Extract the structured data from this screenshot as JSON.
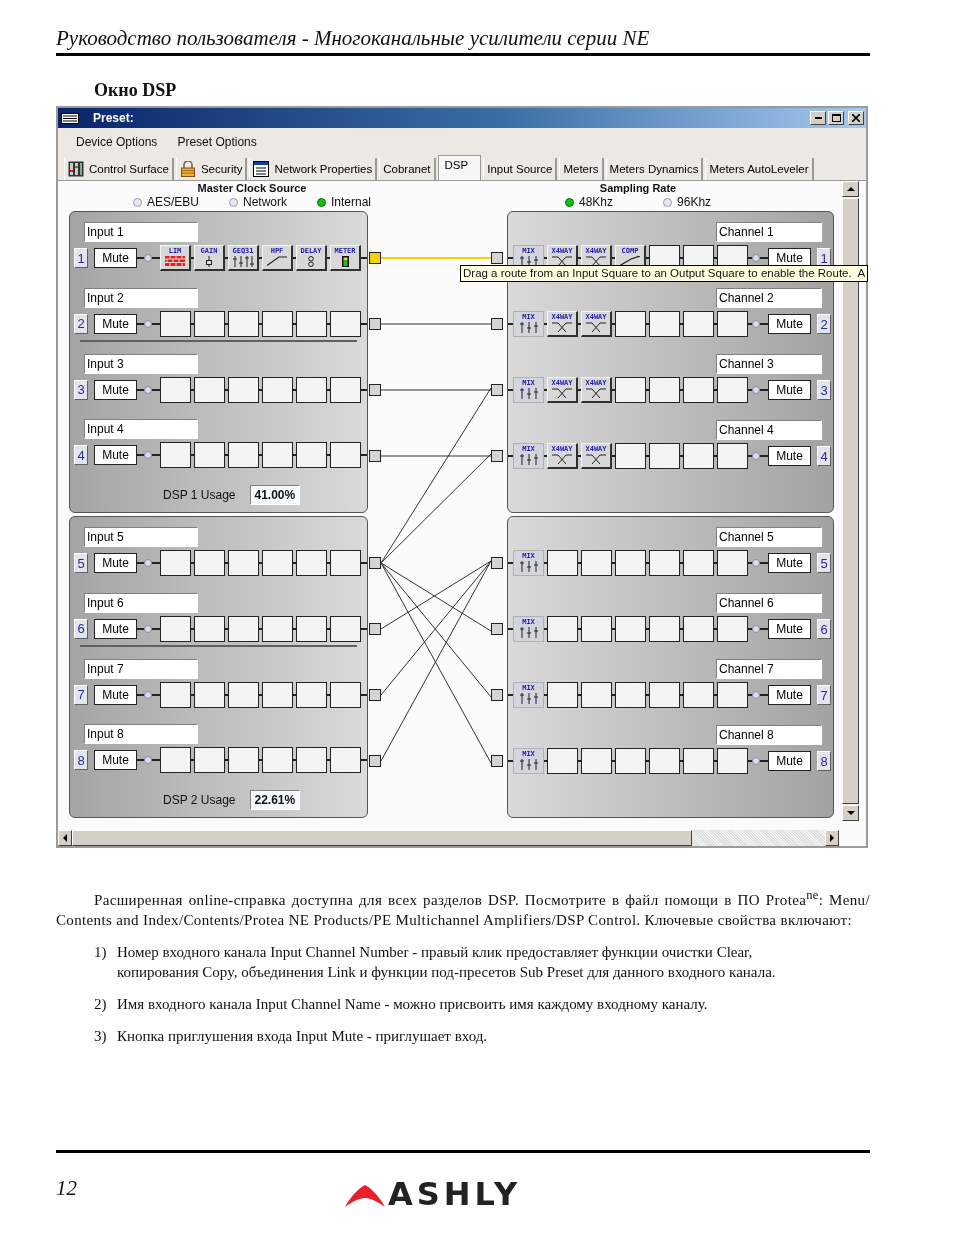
{
  "page_header": {
    "title": "Руководство пользователя - Многоканальные усилители серии NE"
  },
  "section_title": "Окно DSP",
  "window": {
    "title": "Preset:",
    "menu": [
      "Device Options",
      "Preset Options"
    ],
    "tabs": [
      {
        "label": "Control Surface",
        "kind": "surface",
        "selected": false
      },
      {
        "label": "Security",
        "kind": "security",
        "selected": false
      },
      {
        "label": "Network Properties",
        "kind": "network",
        "selected": false
      },
      {
        "label": "Cobranet",
        "kind": "plain",
        "selected": false
      },
      {
        "label": "DSP",
        "kind": "plain",
        "selected": true
      },
      {
        "label": "Input Source",
        "kind": "plain",
        "selected": false
      },
      {
        "label": "Meters",
        "kind": "plain",
        "selected": false
      },
      {
        "label": "Meters Dynamics",
        "kind": "plain",
        "selected": false
      },
      {
        "label": "Meters AutoLeveler",
        "kind": "plain",
        "selected": false
      }
    ],
    "clock_source": {
      "label": "Master Clock Source",
      "options": [
        {
          "label": "AES/EBU",
          "selected": false
        },
        {
          "label": "Network",
          "selected": false
        },
        {
          "label": "Internal",
          "selected": true
        }
      ]
    },
    "sampling_rate": {
      "label": "Sampling Rate",
      "options": [
        {
          "label": "48Khz",
          "selected": true
        },
        {
          "label": "96Khz",
          "selected": false
        }
      ]
    },
    "dsp_units": [
      {
        "usage_label": "DSP 1 Usage",
        "usage": "41.00%",
        "inputs": [
          {
            "number": "1",
            "name": "Input 1",
            "mute": "Mute",
            "route_selected": true,
            "routes": [
              true,
              false,
              false,
              false,
              false,
              false,
              false,
              false
            ],
            "blocks": [
              {
                "kind": "lim",
                "label": "LIM"
              },
              {
                "kind": "gain",
                "label": "GAIN"
              },
              {
                "kind": "geq",
                "label": "GEQ31"
              },
              {
                "kind": "hpf",
                "label": "HPF"
              },
              {
                "kind": "delay",
                "label": "DELAY"
              },
              {
                "kind": "meter",
                "label": "METER"
              }
            ]
          },
          {
            "number": "2",
            "name": "Input 2",
            "mute": "Mute",
            "route_selected": false,
            "routes": [
              false,
              true,
              false,
              false,
              false,
              false,
              false,
              false
            ],
            "blocks": [
              {
                "kind": "empty"
              },
              {
                "kind": "empty"
              },
              {
                "kind": "empty"
              },
              {
                "kind": "empty"
              },
              {
                "kind": "empty"
              },
              {
                "kind": "empty"
              }
            ]
          },
          {
            "number": "3",
            "name": "Input 3",
            "mute": "Mute",
            "route_selected": false,
            "routes": [
              false,
              false,
              true,
              false,
              false,
              false,
              false,
              false
            ],
            "blocks": [
              {
                "kind": "empty"
              },
              {
                "kind": "empty"
              },
              {
                "kind": "empty"
              },
              {
                "kind": "empty"
              },
              {
                "kind": "empty"
              },
              {
                "kind": "empty"
              }
            ]
          },
          {
            "number": "4",
            "name": "Input 4",
            "mute": "Mute",
            "route_selected": false,
            "routes": [
              false,
              false,
              false,
              true,
              false,
              false,
              false,
              false
            ],
            "blocks": [
              {
                "kind": "empty"
              },
              {
                "kind": "empty"
              },
              {
                "kind": "empty"
              },
              {
                "kind": "empty"
              },
              {
                "kind": "empty"
              },
              {
                "kind": "empty"
              }
            ]
          }
        ],
        "outputs": [
          {
            "number": "1",
            "name": "Channel 1",
            "mute": "Mute",
            "blocks": [
              {
                "kind": "mix",
                "label": "MIX"
              },
              {
                "kind": "xover",
                "label": "X4WAY"
              },
              {
                "kind": "xover",
                "label": "X4WAY"
              },
              {
                "kind": "comp",
                "label": "COMP"
              },
              {
                "kind": "empty"
              },
              {
                "kind": "empty"
              },
              {
                "kind": "empty"
              }
            ]
          },
          {
            "number": "2",
            "name": "Channel 2",
            "mute": "Mute",
            "blocks": [
              {
                "kind": "mix",
                "label": "MIX"
              },
              {
                "kind": "xover",
                "label": "X4WAY"
              },
              {
                "kind": "xover",
                "label": "X4WAY"
              },
              {
                "kind": "empty"
              },
              {
                "kind": "empty"
              },
              {
                "kind": "empty"
              },
              {
                "kind": "empty"
              }
            ]
          },
          {
            "number": "3",
            "name": "Channel 3",
            "mute": "Mute",
            "blocks": [
              {
                "kind": "mix",
                "label": "MIX"
              },
              {
                "kind": "xover",
                "label": "X4WAY"
              },
              {
                "kind": "xover",
                "label": "X4WAY"
              },
              {
                "kind": "empty"
              },
              {
                "kind": "empty"
              },
              {
                "kind": "empty"
              },
              {
                "kind": "empty"
              }
            ]
          },
          {
            "number": "4",
            "name": "Channel 4",
            "mute": "Mute",
            "blocks": [
              {
                "kind": "mix",
                "label": "MIX"
              },
              {
                "kind": "xover",
                "label": "X4WAY"
              },
              {
                "kind": "xover",
                "label": "X4WAY"
              },
              {
                "kind": "empty"
              },
              {
                "kind": "empty"
              },
              {
                "kind": "empty"
              },
              {
                "kind": "empty"
              }
            ]
          }
        ]
      },
      {
        "usage_label": "DSP 2 Usage",
        "usage": "22.61%",
        "inputs": [
          {
            "number": "5",
            "name": "Input 5",
            "mute": "Mute",
            "route_selected": false,
            "routes": [
              false,
              false,
              true,
              true,
              false,
              true,
              true,
              true
            ],
            "blocks": [
              {
                "kind": "empty"
              },
              {
                "kind": "empty"
              },
              {
                "kind": "empty"
              },
              {
                "kind": "empty"
              },
              {
                "kind": "empty"
              },
              {
                "kind": "empty"
              }
            ]
          },
          {
            "number": "6",
            "name": "Input 6",
            "mute": "Mute",
            "route_selected": false,
            "routes": [
              false,
              false,
              false,
              false,
              true,
              false,
              false,
              false
            ],
            "blocks": [
              {
                "kind": "empty"
              },
              {
                "kind": "empty"
              },
              {
                "kind": "empty"
              },
              {
                "kind": "empty"
              },
              {
                "kind": "empty"
              },
              {
                "kind": "empty"
              }
            ]
          },
          {
            "number": "7",
            "name": "Input 7",
            "mute": "Mute",
            "route_selected": false,
            "routes": [
              false,
              false,
              false,
              false,
              true,
              false,
              false,
              false
            ],
            "blocks": [
              {
                "kind": "empty"
              },
              {
                "kind": "empty"
              },
              {
                "kind": "empty"
              },
              {
                "kind": "empty"
              },
              {
                "kind": "empty"
              },
              {
                "kind": "empty"
              }
            ]
          },
          {
            "number": "8",
            "name": "Input 8",
            "mute": "Mute",
            "route_selected": false,
            "routes": [
              false,
              false,
              false,
              false,
              true,
              false,
              false,
              false
            ],
            "blocks": [
              {
                "kind": "empty"
              },
              {
                "kind": "empty"
              },
              {
                "kind": "empty"
              },
              {
                "kind": "empty"
              },
              {
                "kind": "empty"
              },
              {
                "kind": "empty"
              }
            ]
          }
        ],
        "outputs": [
          {
            "number": "5",
            "name": "Channel 5",
            "mute": "Mute",
            "blocks": [
              {
                "kind": "mix",
                "label": "MIX"
              },
              {
                "kind": "empty"
              },
              {
                "kind": "empty"
              },
              {
                "kind": "empty"
              },
              {
                "kind": "empty"
              },
              {
                "kind": "empty"
              },
              {
                "kind": "empty"
              }
            ]
          },
          {
            "number": "6",
            "name": "Channel 6",
            "mute": "Mute",
            "blocks": [
              {
                "kind": "mix",
                "label": "MIX"
              },
              {
                "kind": "empty"
              },
              {
                "kind": "empty"
              },
              {
                "kind": "empty"
              },
              {
                "kind": "empty"
              },
              {
                "kind": "empty"
              },
              {
                "kind": "empty"
              }
            ]
          },
          {
            "number": "7",
            "name": "Channel 7",
            "mute": "Mute",
            "blocks": [
              {
                "kind": "mix",
                "label": "MIX"
              },
              {
                "kind": "empty"
              },
              {
                "kind": "empty"
              },
              {
                "kind": "empty"
              },
              {
                "kind": "empty"
              },
              {
                "kind": "empty"
              },
              {
                "kind": "empty"
              }
            ]
          },
          {
            "number": "8",
            "name": "Channel 8",
            "mute": "Mute",
            "blocks": [
              {
                "kind": "mix",
                "label": "MIX"
              },
              {
                "kind": "empty"
              },
              {
                "kind": "empty"
              },
              {
                "kind": "empty"
              },
              {
                "kind": "empty"
              },
              {
                "kind": "empty"
              },
              {
                "kind": "empty"
              }
            ]
          }
        ]
      }
    ],
    "tooltip": "Drag a route from an Input Square to an Output Square to enable the Route.  A"
  },
  "body": {
    "intro": "Расширенная online-справка доступна для всех разделов DSP. Посмотрите в файл помощи в ПО Protea$^{ne}$: Menu/ Contents and Index/Contents/Protea NE Products/PE Multichannel Amplifiers/DSP Control. Ключевые свойства включают:",
    "items": [
      {
        "number": "1)",
        "text": "Номер входного канала Input Channel Number - правый клик предоставляет функции очистки Clear, копирования Copy, объединения Link и функции под-пресетов Sub Preset для данного входного канала."
      },
      {
        "number": "2)",
        "text": "Имя входного канала Input Channel Name - можно присвоить имя каждому входному каналу."
      },
      {
        "number": "3)",
        "text": "Кнопка приглушения входа Input Mute - приглушает вход."
      }
    ]
  },
  "footer": {
    "page_number": "12",
    "logo": "ASHLY"
  }
}
